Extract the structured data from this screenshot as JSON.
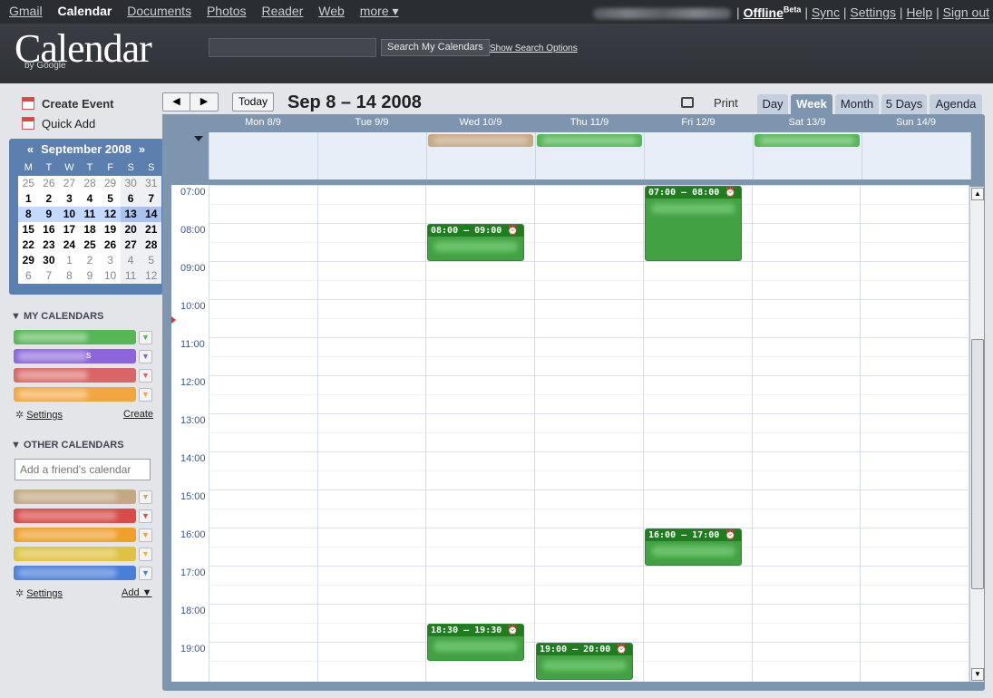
{
  "topnav": {
    "items": [
      "Gmail",
      "Calendar",
      "Documents",
      "Photos",
      "Reader",
      "Web",
      "more ▾"
    ],
    "offline": "Offline",
    "offline_sup": "Beta",
    "sep": "|",
    "links": [
      "Sync",
      "Settings",
      "Help",
      "Sign out"
    ]
  },
  "header": {
    "logo": "Calendar",
    "logo_by": "by Google",
    "search_button": "Search My Calendars",
    "search_options": "Show Search Options"
  },
  "left": {
    "create_event": "Create Event",
    "quick_add": "Quick Add",
    "mini_cal": {
      "title": "September 2008",
      "prev": "«",
      "next": "»",
      "dow": [
        "M",
        "T",
        "W",
        "T",
        "F",
        "S",
        "S"
      ],
      "weeks": [
        [
          "25",
          "26",
          "27",
          "28",
          "29",
          "30",
          "31"
        ],
        [
          "1",
          "2",
          "3",
          "4",
          "5",
          "6",
          "7"
        ],
        [
          "8",
          "9",
          "10",
          "11",
          "12",
          "13",
          "14"
        ],
        [
          "15",
          "16",
          "17",
          "18",
          "19",
          "20",
          "21"
        ],
        [
          "22",
          "23",
          "24",
          "25",
          "26",
          "27",
          "28"
        ],
        [
          "29",
          "30",
          "1",
          "2",
          "3",
          "4",
          "5"
        ],
        [
          "6",
          "7",
          "8",
          "9",
          "10",
          "11",
          "12"
        ]
      ]
    },
    "my_calendars_title": "MY CALENDARS",
    "my_calendars": [
      {
        "color": "#55b755",
        "label": ""
      },
      {
        "color": "#8c66d9",
        "label": "s"
      },
      {
        "color": "#d96666",
        "label": ""
      },
      {
        "color": "#f2a640",
        "label": ""
      }
    ],
    "settings_label": "Settings",
    "create_label": "Create",
    "other_calendars_title": "OTHER CALENDARS",
    "friend_placeholder": "Add a friend's calendar",
    "other_calendars": [
      {
        "color": "#c4a883"
      },
      {
        "color": "#d94a4a"
      },
      {
        "color": "#f09f2a"
      },
      {
        "color": "#e0c240"
      },
      {
        "color": "#4a7fd9"
      }
    ],
    "other_settings_label": "Settings",
    "add_label": "Add ▼"
  },
  "toolbar": {
    "prev": "◀",
    "next": "▶",
    "today": "Today",
    "date_range": "Sep 8 – 14 2008",
    "print": "Print",
    "tabs": [
      "Day",
      "Week",
      "Month",
      "5 Days",
      "Agenda"
    ],
    "active_tab": "Week"
  },
  "grid": {
    "days": [
      "Mon 8/9",
      "Tue 9/9",
      "Wed 10/9",
      "Thu 11/9",
      "Fri 12/9",
      "Sat 13/9",
      "Sun 14/9"
    ],
    "hours": [
      "07:00",
      "08:00",
      "09:00",
      "10:00",
      "11:00",
      "12:00",
      "13:00",
      "14:00",
      "15:00",
      "16:00",
      "17:00",
      "18:00",
      "19:00"
    ],
    "events": [
      {
        "day": "Wed 10/9",
        "label": "08:00 – 09:00 ⏰",
        "start": "08:00",
        "end": "09:00"
      },
      {
        "day": "Fri 12/9",
        "label": "07:00 – 08:00 ⏰",
        "start": "07:00",
        "end": "09:00"
      },
      {
        "day": "Fri 12/9",
        "label": "16:00 – 17:00 ⏰",
        "start": "16:00",
        "end": "17:00"
      },
      {
        "day": "Wed 10/9",
        "label": "18:30 – 19:30 ⏰",
        "start": "18:30",
        "end": "19:30"
      },
      {
        "day": "Thu 11/9",
        "label": "19:00 – 20:00 ⏰",
        "start": "19:00",
        "end": "20:00"
      }
    ],
    "allday_events": [
      {
        "day": "Wed 10/9",
        "color": "#c4a883"
      },
      {
        "day": "Thu 11/9",
        "color": "#55b755"
      },
      {
        "day": "Sat 13/9",
        "color": "#55b755"
      }
    ]
  }
}
